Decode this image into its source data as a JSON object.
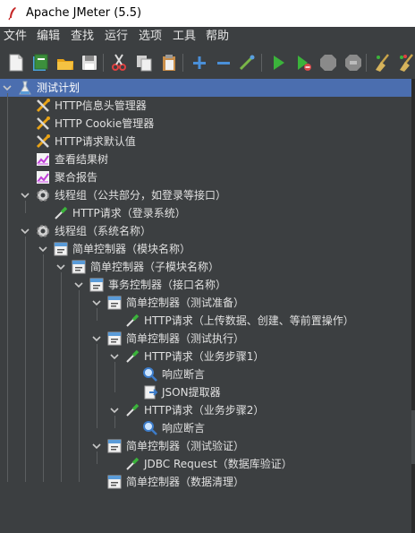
{
  "window": {
    "title": "Apache JMeter (5.5)",
    "icon": "feather-icon"
  },
  "menu": [
    "文件",
    "编辑",
    "查找",
    "运行",
    "选项",
    "工具",
    "帮助"
  ],
  "toolbar": [
    {
      "name": "new-button",
      "icon": "new-document-icon"
    },
    {
      "name": "templates-button",
      "icon": "templates-icon"
    },
    {
      "name": "open-button",
      "icon": "open-folder-icon"
    },
    {
      "name": "save-button",
      "icon": "save-icon"
    },
    {
      "name": "cut-button",
      "icon": "scissors-icon"
    },
    {
      "name": "copy-button",
      "icon": "copy-icon"
    },
    {
      "name": "paste-button",
      "icon": "paste-icon"
    },
    {
      "name": "expand-button",
      "icon": "plus-icon"
    },
    {
      "name": "collapse-button",
      "icon": "minus-icon"
    },
    {
      "name": "toggle-button",
      "icon": "toggle-icon"
    },
    {
      "name": "start-button",
      "icon": "play-icon"
    },
    {
      "name": "start-no-pause-button",
      "icon": "play-no-timers-icon"
    },
    {
      "name": "stop-button",
      "icon": "stop-icon"
    },
    {
      "name": "shutdown-button",
      "icon": "shutdown-icon"
    },
    {
      "name": "clear-button",
      "icon": "broom-icon"
    },
    {
      "name": "clear-all-button",
      "icon": "broom-all-icon"
    }
  ],
  "tree": [
    {
      "label": "测试计划",
      "level": 0,
      "icon": "test-plan-icon",
      "expanded": true,
      "selected": true
    },
    {
      "label": "HTTP信息头管理器",
      "level": 1,
      "icon": "config-wrench-icon"
    },
    {
      "label": "HTTP Cookie管理器",
      "level": 1,
      "icon": "config-wrench-icon"
    },
    {
      "label": "HTTP请求默认值",
      "level": 1,
      "icon": "config-wrench-icon"
    },
    {
      "label": "查看结果树",
      "level": 1,
      "icon": "listener-chart-icon"
    },
    {
      "label": "聚合报告",
      "level": 1,
      "icon": "listener-chart-icon"
    },
    {
      "label": "线程组（公共部分，如登录等接口）",
      "level": 1,
      "icon": "thread-group-gear-icon",
      "expanded": true
    },
    {
      "label": "HTTP请求（登录系统）",
      "level": 2,
      "icon": "sampler-pipette-icon"
    },
    {
      "label": "线程组（系统名称）",
      "level": 1,
      "icon": "thread-group-gear-icon",
      "expanded": true
    },
    {
      "label": "简单控制器（模块名称）",
      "level": 2,
      "icon": "controller-icon",
      "expanded": true
    },
    {
      "label": "简单控制器（子模块名称）",
      "level": 3,
      "icon": "controller-icon",
      "expanded": true
    },
    {
      "label": "事务控制器（接口名称）",
      "level": 4,
      "icon": "controller-icon",
      "expanded": true
    },
    {
      "label": "简单控制器（测试准备）",
      "level": 5,
      "icon": "controller-icon",
      "expanded": true
    },
    {
      "label": "HTTP请求（上传数据、创建、等前置操作）",
      "level": 6,
      "icon": "sampler-pipette-icon"
    },
    {
      "label": "简单控制器（测试执行）",
      "level": 5,
      "icon": "controller-icon",
      "expanded": true
    },
    {
      "label": "HTTP请求（业务步骤1）",
      "level": 6,
      "icon": "sampler-pipette-icon",
      "expanded": true
    },
    {
      "label": "响应断言",
      "level": 7,
      "icon": "assertion-magnifier-icon"
    },
    {
      "label": "JSON提取器",
      "level": 7,
      "icon": "extractor-icon"
    },
    {
      "label": "HTTP请求（业务步骤2）",
      "level": 6,
      "icon": "sampler-pipette-icon",
      "expanded": true
    },
    {
      "label": "响应断言",
      "level": 7,
      "icon": "assertion-magnifier-icon"
    },
    {
      "label": "简单控制器（测试验证）",
      "level": 5,
      "icon": "controller-icon",
      "expanded": true
    },
    {
      "label": "JDBC Request（数据库验证）",
      "level": 6,
      "icon": "sampler-pipette-icon"
    },
    {
      "label": "简单控制器（数据清理）",
      "level": 5,
      "icon": "controller-icon"
    }
  ],
  "colors": {
    "background": "#3c3f41",
    "selection": "#4b6eaf",
    "text": "#e0e0e0",
    "accent_green": "#3bb33b",
    "accent_blue": "#5a9bd8"
  }
}
